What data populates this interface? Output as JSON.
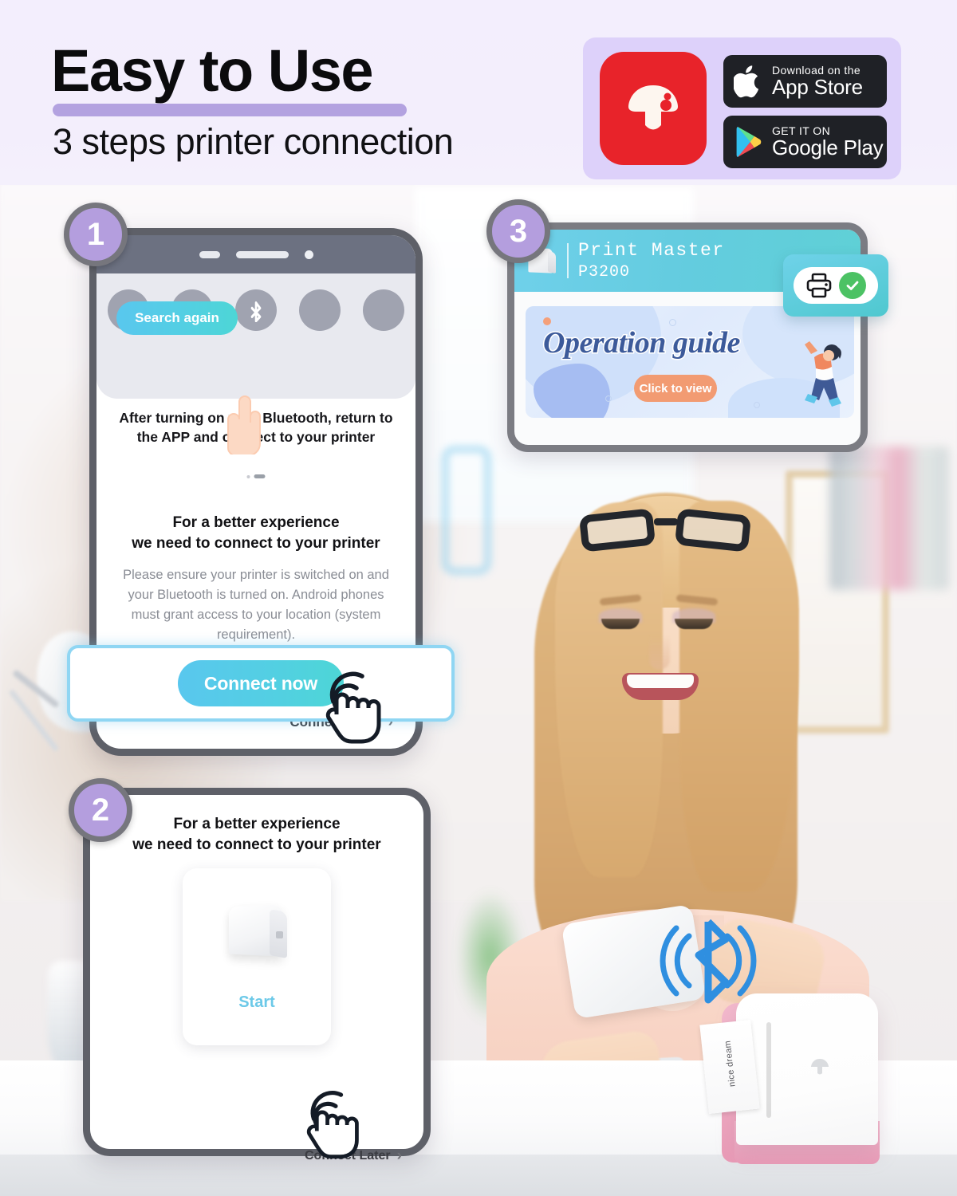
{
  "header": {
    "title": "Easy to Use",
    "subtitle": "3 steps printer connection",
    "app_icon_name": "mushroom-app-icon",
    "app_icon_color": "#e8232a",
    "badge_panel_color": "#ddd1fa",
    "stores": [
      {
        "small": "Download on the",
        "big": "App Store",
        "icon": "apple-icon"
      },
      {
        "small": "GET IT ON",
        "big": "Google Play",
        "icon": "google-play-icon"
      }
    ]
  },
  "steps": [
    {
      "number": "1"
    },
    {
      "number": "2"
    },
    {
      "number": "3"
    }
  ],
  "step1": {
    "quick_settings": {
      "bluetooth_icon": "bluetooth-icon",
      "toggle_count": 5,
      "active_index": 2
    },
    "notice": "After turning on your Bluetooth, return to the APP and connect to your printer",
    "heading": "For a better experience\nwe need to connect to your printer",
    "body": "Please ensure your printer is switched on and your Bluetooth is turned on. Android phones must grant access to your location (system requirement).",
    "primary_button": "Connect now",
    "secondary_link": "Connect Later",
    "button_gradient_start": "#59c7ee",
    "button_gradient_end": "#4dd6d6",
    "highlight_border_color": "#8fd6f3"
  },
  "step2": {
    "heading_line1": "For a better experience",
    "heading_line2": "we need to connect to your printer",
    "device_action": "Start",
    "primary_button": "Search again",
    "secondary_link": "Connect Later"
  },
  "step3": {
    "device_name": "Print Master",
    "device_model": "P3200",
    "status_printer_icon": "printer-icon",
    "status_check_icon": "check-circle-icon",
    "banner_title": "Operation guide",
    "banner_button": "Click to view",
    "banner_button_color": "#f29b72",
    "header_gradient_start": "#6fd0ea",
    "header_gradient_end": "#5fd0d6"
  },
  "scene": {
    "bluetooth_broadcast_icon": "bluetooth-broadcast-icon",
    "bluetooth_color": "#2f8fe0",
    "printer_label_text": "nice dream",
    "printer_body_color": "#ffffff",
    "printer_accent_color": "#efa9c1"
  }
}
